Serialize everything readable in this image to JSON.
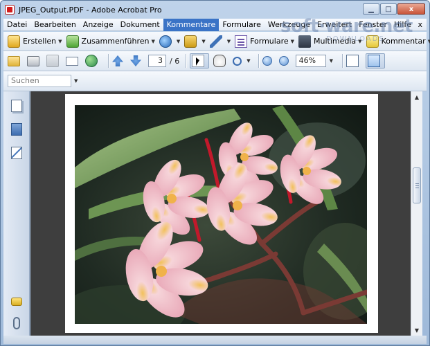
{
  "window": {
    "title": "JPEG_Output.PDF - Adobe Acrobat Pro",
    "minimize_label": "▁",
    "maximize_label": "□",
    "close_label": "x"
  },
  "menu": {
    "items": [
      "Datei",
      "Bearbeiten",
      "Anzeige",
      "Dokument",
      "Kommentare",
      "Formulare",
      "Werkzeuge",
      "Erweitert",
      "Fenster",
      "Hilfe"
    ],
    "active": "Kommentare",
    "close_label": "x"
  },
  "toolbar1": {
    "create_label": "Erstellen",
    "combine_label": "Zusammenführen",
    "forms_label": "Formulare",
    "multimedia_label": "Multimedia",
    "comment_label": "Kommentar"
  },
  "toolbar2": {
    "page_current": "3",
    "page_total": "/ 6",
    "zoom_value": "46%"
  },
  "toolbar3": {
    "search_placeholder": "Suchen"
  },
  "watermark": {
    "text": "soft·ware.net",
    "sub": "DOWNLOADS"
  },
  "scrollbar": {
    "up_arrow": "▲",
    "down_arrow": "▼",
    "position": 0.35
  },
  "colors": {
    "menu_active": "#3a73c6",
    "document_background": "#3e3e3e",
    "acrobat_red": "#d21b1b"
  },
  "icons": [
    "pdf-icon",
    "create-icon",
    "combine-icon",
    "share-icon",
    "lock-icon",
    "pen-icon",
    "forms-icon",
    "multimedia-icon",
    "comment-icon",
    "open-folder-icon",
    "print-icon",
    "save-icon",
    "email-icon",
    "globe-icon",
    "arrow-up-icon",
    "arrow-down-icon",
    "select-tool-icon",
    "hand-tool-icon",
    "zoom-tool-icon",
    "zoom-out-icon",
    "zoom-in-icon",
    "fit-page-icon",
    "fit-width-icon",
    "pages-panel-icon",
    "bookmarks-panel-icon",
    "signatures-panel-icon",
    "comments-panel-icon",
    "attachments-panel-icon"
  ]
}
